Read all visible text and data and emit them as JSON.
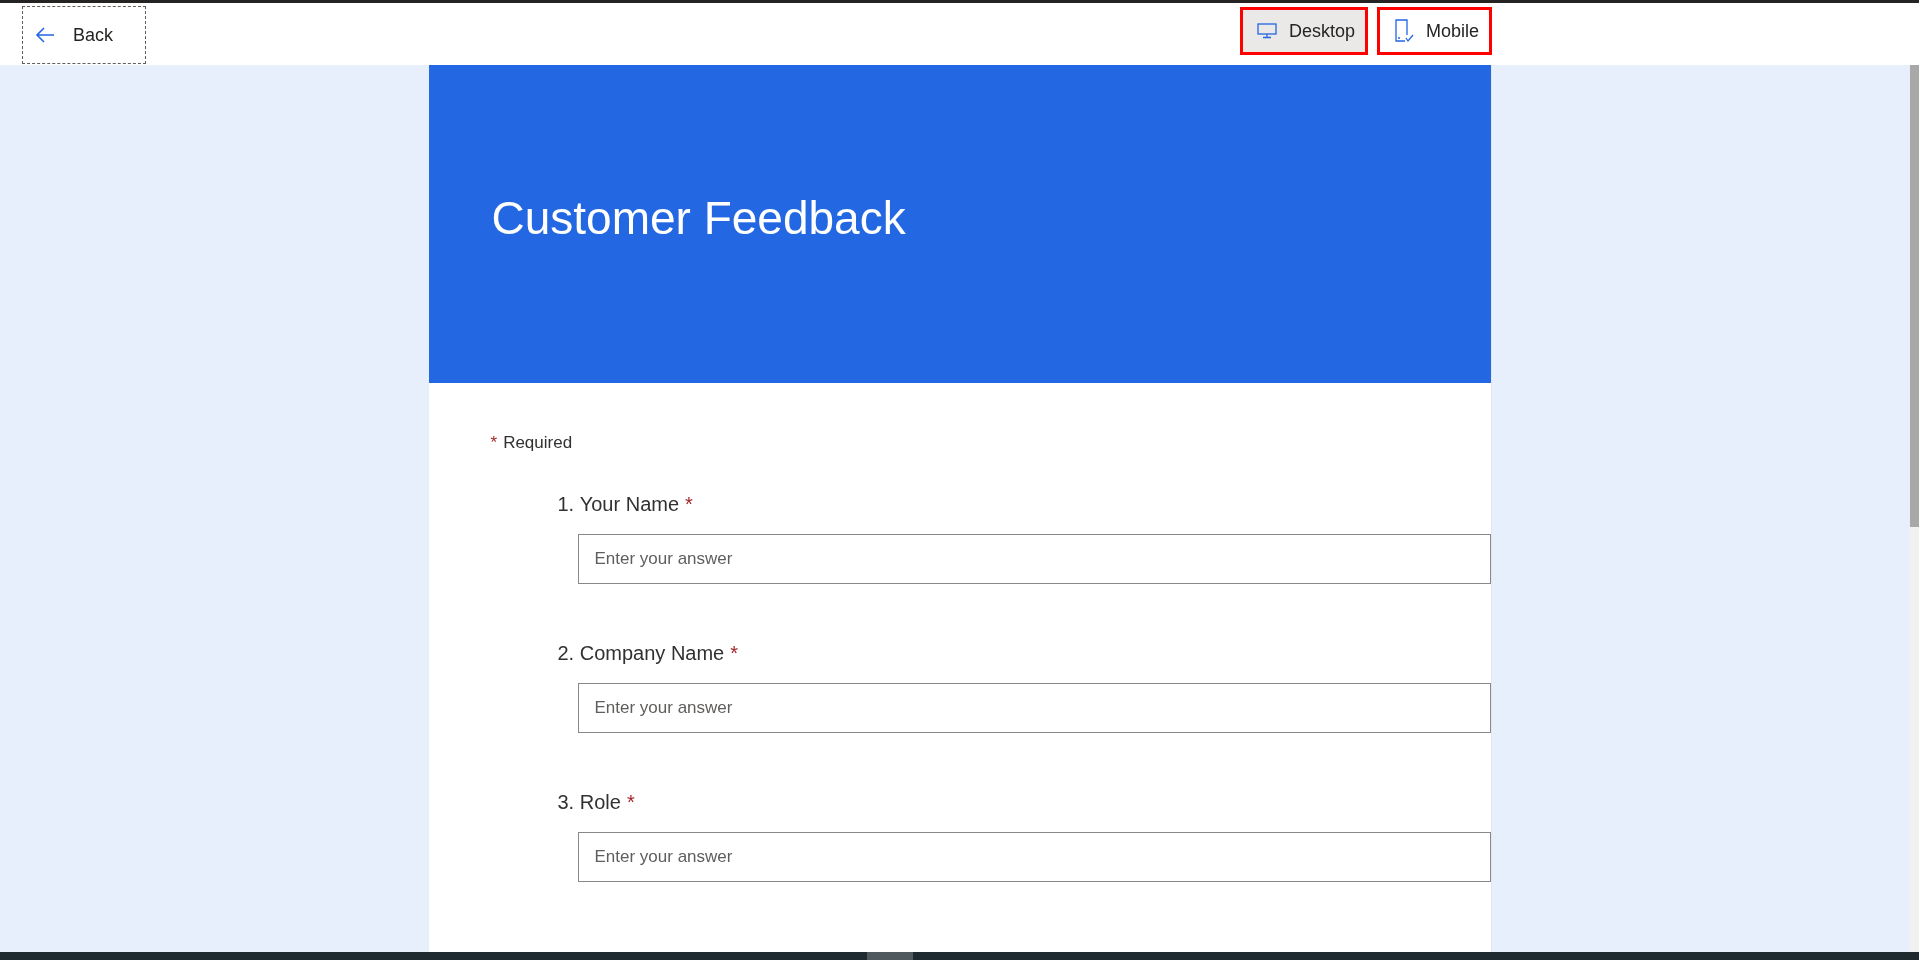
{
  "toolbar": {
    "back": {
      "label": "Back"
    },
    "views": [
      {
        "label": "Desktop",
        "kind": "desktop",
        "selected": true,
        "highlighted": true
      },
      {
        "label": "Mobile",
        "kind": "mobile",
        "selected": false,
        "highlighted": true
      }
    ]
  },
  "form": {
    "title": "Customer Feedback",
    "required_note": {
      "mark": "*",
      "label": "Required"
    },
    "questions": [
      {
        "number": "1.",
        "label": "Your Name",
        "required_mark": "*",
        "placeholder": "Enter your answer"
      },
      {
        "number": "2.",
        "label": "Company Name",
        "required_mark": "*",
        "placeholder": "Enter your answer"
      },
      {
        "number": "3.",
        "label": "Role",
        "required_mark": "*",
        "placeholder": "Enter your answer"
      }
    ]
  }
}
